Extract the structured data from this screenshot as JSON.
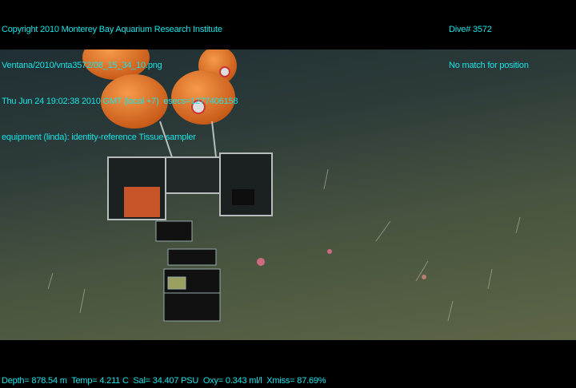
{
  "header_left": {
    "copyright": "Copyright 2010 Monterey Bay Aquarium Research Institute",
    "file": "Ventana/2010/vnta3572/08_15_34_10.png",
    "timestamp": "Thu Jun 24 19:02:38 2010 GMT (local +7)  esecs=1277406158",
    "equipment": "equipment (linda): identity-reference Tissue sampler"
  },
  "header_right": {
    "dive": "Dive# 3572",
    "position": "No match for position"
  },
  "footer": {
    "readout": "Depth= 878.54 m  Temp= 4.211 C  Sal= 34.407 PSU  Oxy= 0.343 ml/l  Xmiss= 87.69%"
  },
  "colors": {
    "overlay_text": "#19e3e6",
    "floats": "#e8772a"
  }
}
